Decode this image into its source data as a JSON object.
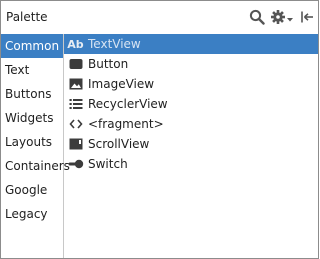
{
  "header": {
    "title": "Palette",
    "icons": [
      "search-icon",
      "gear-icon",
      "collapse-icon"
    ]
  },
  "sidebar": {
    "selected_index": 0,
    "items": [
      {
        "label": "Common"
      },
      {
        "label": "Text"
      },
      {
        "label": "Buttons"
      },
      {
        "label": "Widgets"
      },
      {
        "label": "Layouts"
      },
      {
        "label": "Containers"
      },
      {
        "label": "Google"
      },
      {
        "label": "Legacy"
      }
    ]
  },
  "content": {
    "selected_index": 0,
    "items": [
      {
        "label": "TextView",
        "icon": "textview-icon",
        "icon_text": "Ab"
      },
      {
        "label": "Button",
        "icon": "button-icon"
      },
      {
        "label": "ImageView",
        "icon": "imageview-icon"
      },
      {
        "label": "RecyclerView",
        "icon": "recyclerview-icon"
      },
      {
        "label": "<fragment>",
        "icon": "fragment-icon"
      },
      {
        "label": "ScrollView",
        "icon": "scrollview-icon"
      },
      {
        "label": "Switch",
        "icon": "switch-icon"
      }
    ]
  },
  "colors": {
    "accent": "#3b7fc4",
    "icon": "#3c3c3c",
    "border": "#8c8c8c"
  }
}
